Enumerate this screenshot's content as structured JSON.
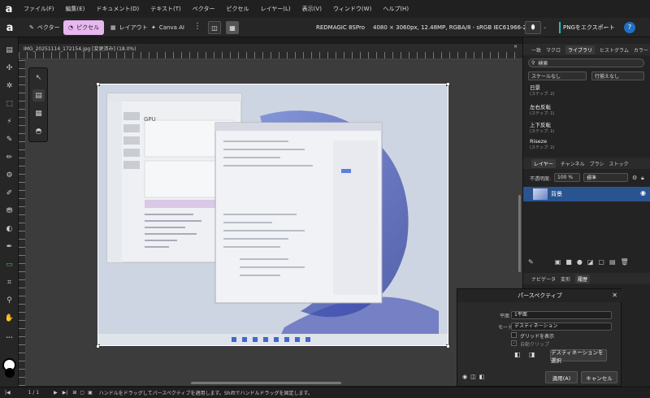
{
  "menu": [
    "ファイル(F)",
    "編集(E)",
    "ドキュメント(D)",
    "テキスト(T)",
    "ベクター",
    "ピクセル",
    "レイヤー(L)",
    "表示(V)",
    "ウィンドウ(W)",
    "ヘルプ(H)"
  ],
  "toolbar": {
    "personas": {
      "vector": "ベクター",
      "pixel": "ピクセル",
      "layout": "レイアウト",
      "canva": "Canva AI"
    },
    "camera": "REDMAGIC 8SPro",
    "image_info": "4080 × 3060px, 12.48MP, RGBA/8 - sRGB IEC61966-2.1",
    "export": "PNGをエクスポート",
    "help": "?"
  },
  "document": {
    "tab_title": "IMG_20251114_172154.jpg [変更済み] (18.0%)",
    "close": "×"
  },
  "right_panel": {
    "tabs": [
      "一致",
      "マクロ",
      "ライブラリ",
      "ヒストグラム",
      "カラー"
    ],
    "search_placeholder": "検索",
    "scale_select": "スケールなし",
    "rows_select": "行揃えなし",
    "history": [
      {
        "label": "日景",
        "steps": "(ステップ: 2)"
      },
      {
        "label": "左右反転",
        "steps": "(ステップ: 1)"
      },
      {
        "label": "上下反転",
        "steps": "(ステップ: 1)"
      },
      {
        "label": "Riseze",
        "steps": "(ステップ: 2)"
      }
    ],
    "layer_tabs": [
      "レイヤー",
      "チャンネル",
      "ブラシ",
      "ストック"
    ],
    "opacity_label": "不透明度:",
    "opacity_value": "100 %",
    "blend_mode": "標準",
    "layer_name": "背景",
    "nav_tabs": [
      "ナビゲータ",
      "変形",
      "履歴"
    ]
  },
  "perspective_dialog": {
    "title": "パースペクティブ",
    "plane_label": "平面",
    "plane_value": "1平面",
    "mode_label": "モード",
    "mode_value": "デスティネーション",
    "grid_label": "グリッドを表示",
    "autoclip_label": "自動クリップ",
    "select_dest": "デスティネーションを選択",
    "apply": "適用(A)",
    "cancel": "キャンセル"
  },
  "status": {
    "page": "1 / 1",
    "hint": "ハンドルをドラッグしてパースペクティブを適用します。Shiftでハンドルドラッグを固定します。"
  },
  "screenshot_content": {
    "gpu_label": "GPU"
  }
}
